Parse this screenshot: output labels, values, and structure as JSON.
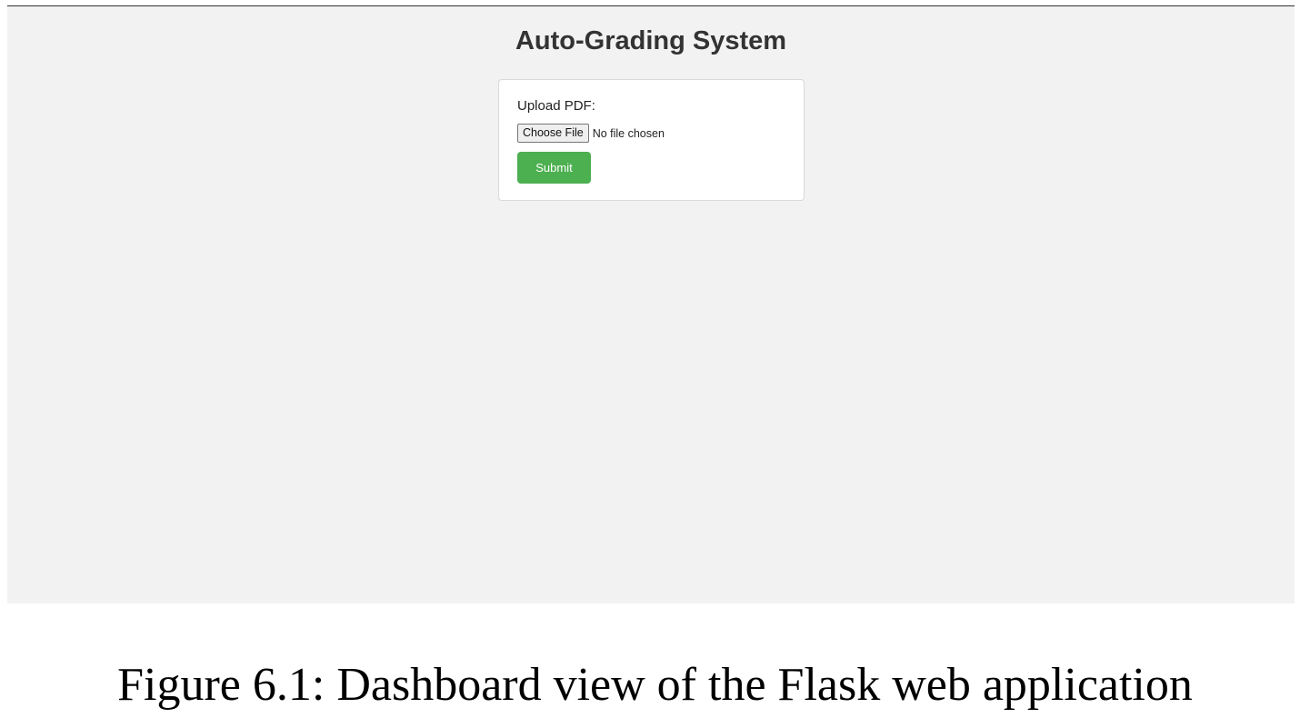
{
  "page": {
    "title": "Auto-Grading System"
  },
  "upload_form": {
    "label": "Upload PDF:",
    "choose_file_label": "Choose File",
    "file_status": "No file chosen",
    "submit_label": "Submit",
    "submit_color": "#4caf50"
  },
  "caption": "Figure 6.1: Dashboard view of the Flask web application"
}
